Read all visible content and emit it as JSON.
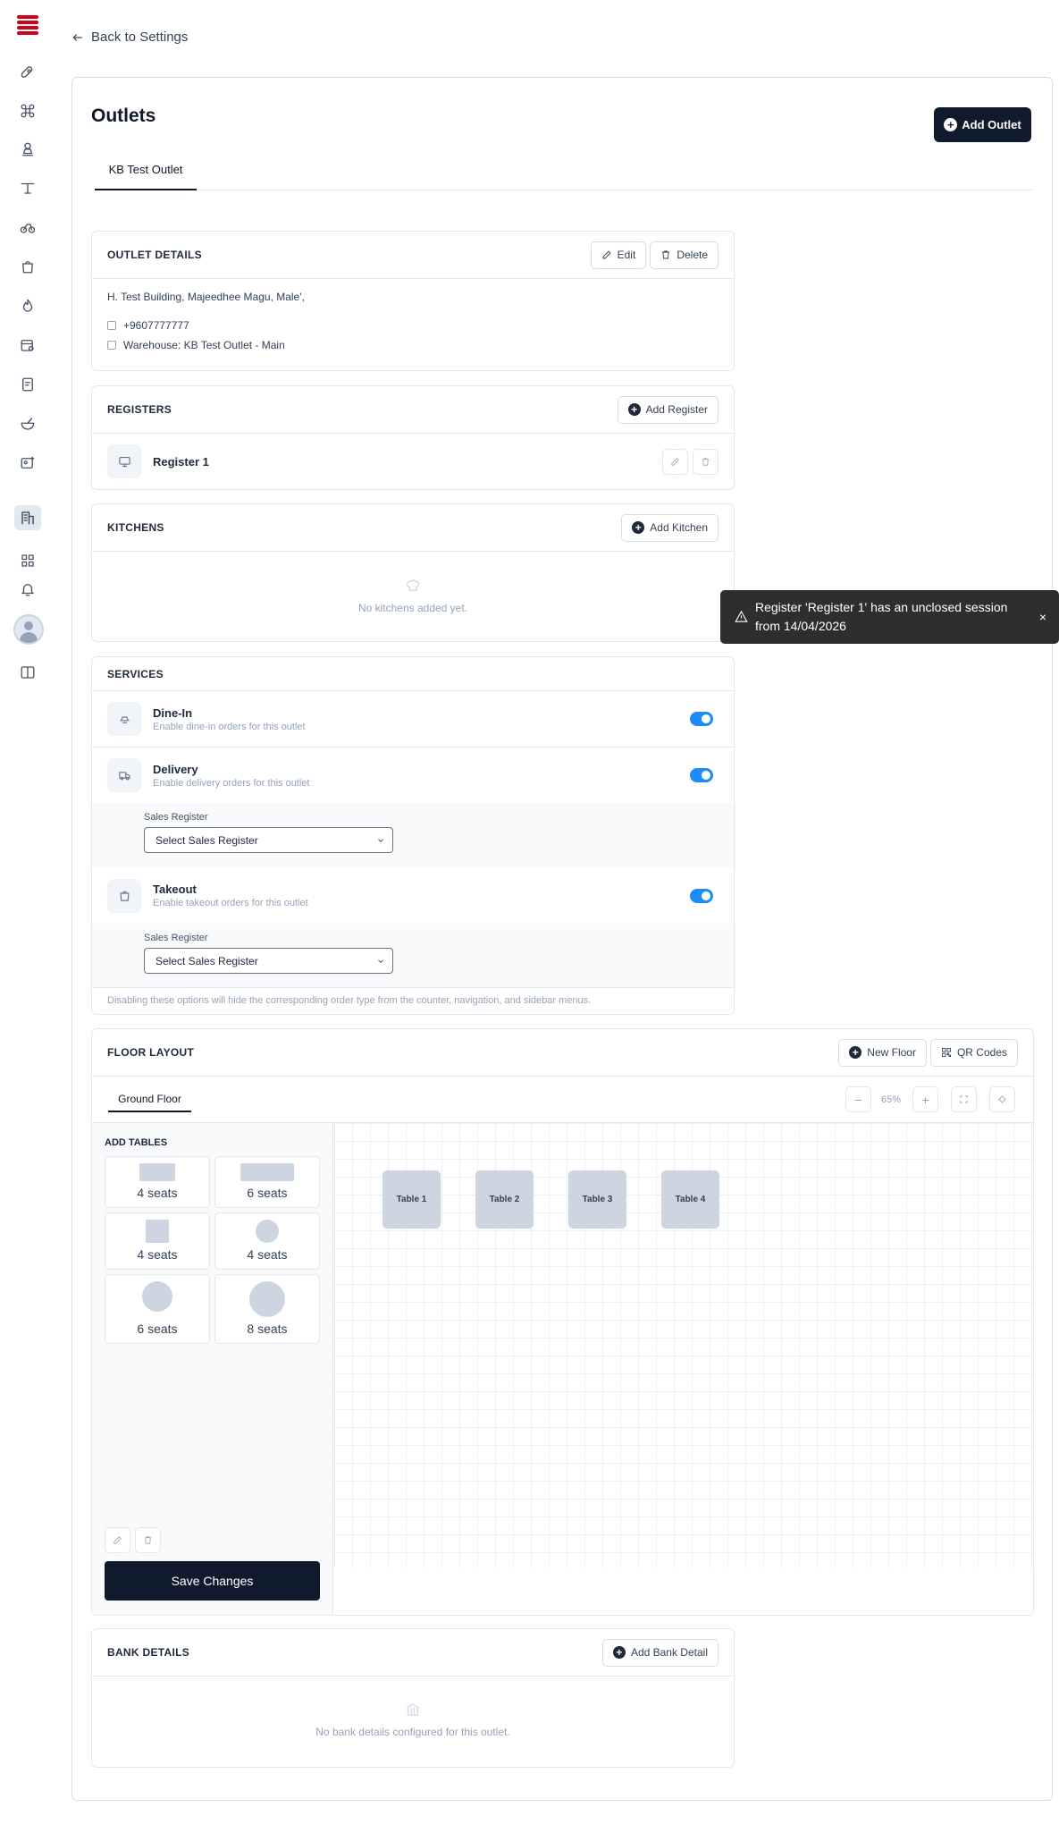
{
  "back_link": "Back to Settings",
  "page_title": "Outlets",
  "add_outlet_label": "Add Outlet",
  "outlet_tab": "KB Test Outlet",
  "outlet_details": {
    "title": "OUTLET DETAILS",
    "edit_label": "Edit",
    "delete_label": "Delete",
    "address": "H. Test Building, Majeedhee Magu, Male',",
    "phone": "+9607777777",
    "warehouse": "Warehouse: KB Test Outlet - Main"
  },
  "registers": {
    "title": "REGISTERS",
    "add_label": "Add Register",
    "items": [
      {
        "name": "Register 1"
      }
    ]
  },
  "kitchens": {
    "title": "KITCHENS",
    "add_label": "Add Kitchen",
    "empty_text": "No kitchens added yet."
  },
  "services": {
    "title": "SERVICES",
    "items": [
      {
        "name": "Dine-In",
        "desc": "Enable dine-in orders for this outlet",
        "enabled": true
      },
      {
        "name": "Delivery",
        "desc": "Enable delivery orders for this outlet",
        "enabled": true,
        "sales_register_label": "Sales Register",
        "sales_register_value": "Select Sales Register"
      },
      {
        "name": "Takeout",
        "desc": "Enable takeout orders for this outlet",
        "enabled": true,
        "sales_register_label": "Sales Register",
        "sales_register_value": "Select Sales Register"
      }
    ],
    "footnote": "Disabling these options will hide the corresponding order type from the counter, navigation, and sidebar menus."
  },
  "toast": {
    "message": "Register 'Register 1' has an unclosed session from 14/04/2026",
    "close": "×"
  },
  "floor_layout": {
    "title": "FLOOR LAYOUT",
    "new_floor_label": "New Floor",
    "qr_codes_label": "QR Codes",
    "floor_tab": "Ground Floor",
    "zoom": "65%",
    "add_tables_title": "ADD TABLES",
    "templates": [
      "4 seats",
      "6 seats",
      "4 seats",
      "4 seats",
      "6 seats",
      "8 seats"
    ],
    "tables": [
      "Table 1",
      "Table 2",
      "Table 3",
      "Table 4"
    ],
    "save_label": "Save Changes"
  },
  "bank_details": {
    "title": "BANK DETAILS",
    "add_label": "Add Bank Detail",
    "empty_text": "No bank details configured for this outlet."
  },
  "colors": {
    "accent": "#1d8cf8",
    "primary_dark": "#0f1b2d",
    "brand_red": "#d0021b"
  }
}
